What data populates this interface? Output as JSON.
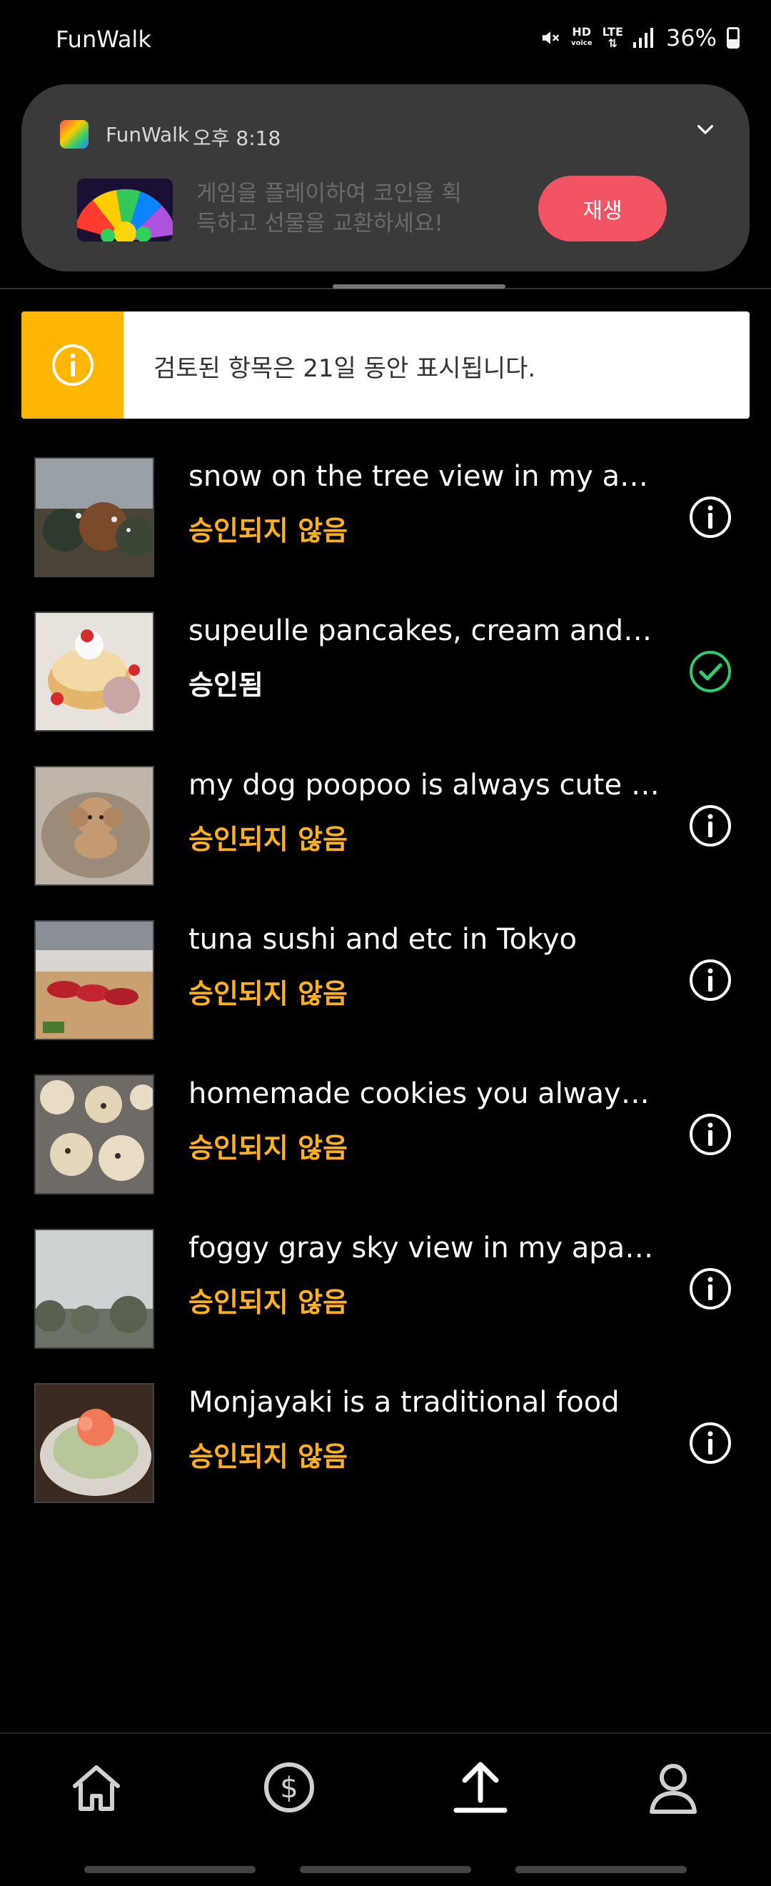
{
  "status_bar": {
    "app_name": "FunWalk",
    "battery": "36%",
    "network_hd": "HD",
    "network_voice": "voice",
    "network_lte": "LTE"
  },
  "notification": {
    "app_name": "FunWalk",
    "time": "오후 8:18",
    "text": "게임을 플레이하여 코인을 획득하고 선물을 교환하세요!",
    "play_button": "재생"
  },
  "banner": {
    "text": "검토된 항목은 21일 동안 표시됩니다."
  },
  "items": [
    {
      "title": "snow on the tree view in my apartment",
      "status": "승인되지 않음",
      "state": "pending",
      "icon": "info-icon"
    },
    {
      "title": "supeulle pancakes, cream and strawberry",
      "status": "승인됨",
      "state": "approved",
      "icon": "check-circle-icon"
    },
    {
      "title": "my dog poopoo is always cute so",
      "status": "승인되지 않음",
      "state": "pending",
      "icon": "info-icon"
    },
    {
      "title": "tuna sushi and etc in Tokyo",
      "status": "승인되지 않음",
      "state": "pending",
      "icon": "info-icon"
    },
    {
      "title": "homemade cookies you always love",
      "status": "승인되지 않음",
      "state": "pending",
      "icon": "info-icon"
    },
    {
      "title": "foggy gray sky view in my apartment",
      "status": "승인되지 않음",
      "state": "pending",
      "icon": "info-icon"
    },
    {
      "title": " Monjayaki is a traditional food",
      "status": "승인되지 않음",
      "state": "pending",
      "icon": "info-icon"
    }
  ],
  "nav": {
    "items": [
      "home-icon",
      "dollar-coin-icon",
      "upload-icon",
      "profile-icon"
    ],
    "active": "upload-icon"
  },
  "colors": {
    "pending": "#ffb020",
    "approved_check": "#2ecc71",
    "play_button": "#f25464",
    "banner_accent": "#ffb703"
  }
}
